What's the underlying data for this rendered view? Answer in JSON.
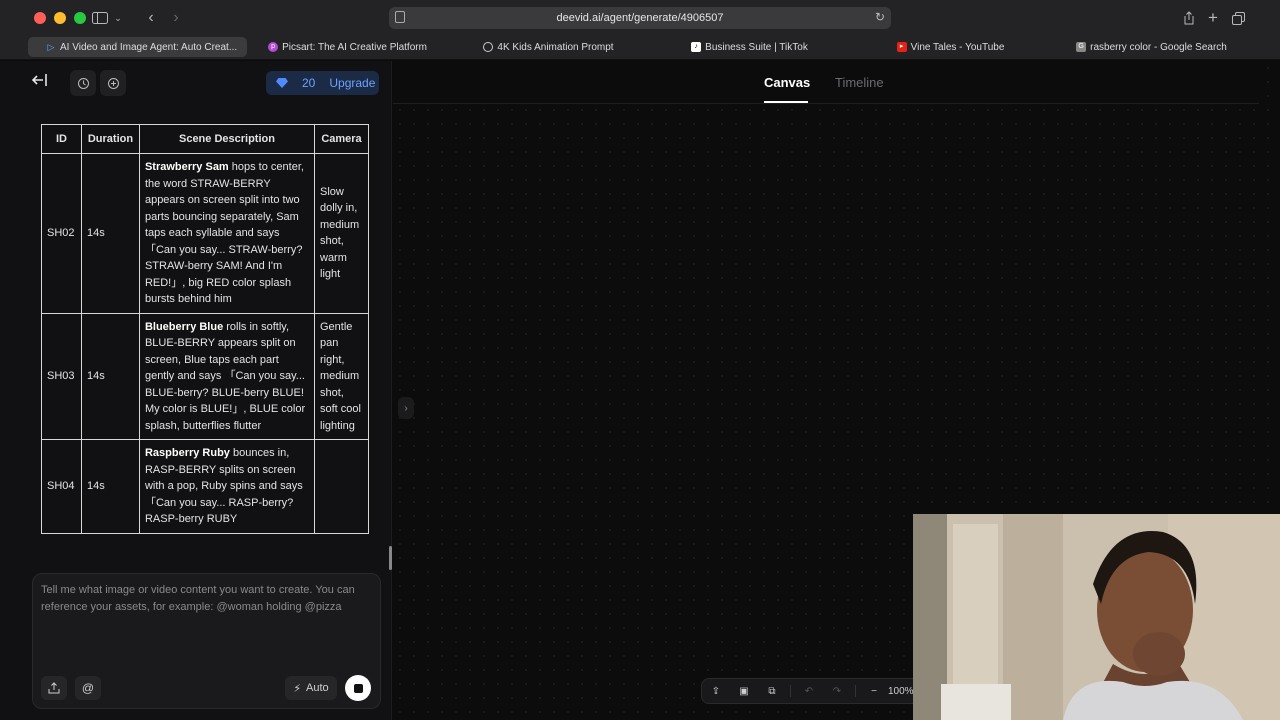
{
  "browser": {
    "url": "deevid.ai/agent/generate/4906507",
    "tabs": [
      {
        "label": "AI Video and Image Agent: Auto Creat...",
        "favicon": "play-icon",
        "active": true
      },
      {
        "label": "Picsart: The AI Creative Platform",
        "favicon": "picsart-icon"
      },
      {
        "label": "4K Kids Animation Prompt",
        "favicon": "openai-icon"
      },
      {
        "label": "Business Suite | TikTok",
        "favicon": "tiktok-icon"
      },
      {
        "label": "Vine Tales - YouTube",
        "favicon": "youtube-icon"
      },
      {
        "label": "rasberry color - Google Search",
        "favicon": "google-icon"
      }
    ]
  },
  "header": {
    "credits": "20",
    "upgrade_label": "Upgrade"
  },
  "table": {
    "headers": [
      "ID",
      "Duration",
      "Scene Description",
      "Camera"
    ],
    "rows": [
      {
        "id": "SH02",
        "duration": "14s",
        "name": "Strawberry Sam",
        "desc": " hops to center, the word STRAW-BERRY appears on screen split into two parts bouncing separately, Sam taps each syllable and says 「Can you say... STRAW-berry? STRAW-berry SAM! And I'm RED!」, big RED color splash bursts behind him",
        "camera": "Slow dolly in, medium shot, warm light"
      },
      {
        "id": "SH03",
        "duration": "14s",
        "name": "Blueberry Blue",
        "desc": " rolls in softly, BLUE-BERRY appears split on screen, Blue taps each part gently and says 「Can you say... BLUE-berry? BLUE-berry BLUE! My color is BLUE!」, BLUE color splash, butterflies flutter",
        "camera": "Gentle pan right, medium shot, soft cool lighting"
      },
      {
        "id": "SH04",
        "duration": "14s",
        "name": "Raspberry Ruby",
        "desc": " bounces in, RASP-BERRY splits on screen with a pop, Ruby spins and says 「Can you say... RASP-berry? RASP-berry RUBY",
        "camera": ""
      }
    ]
  },
  "composer": {
    "placeholder": "Tell me what image or video content you want to create. You can reference your assets, for example: @woman holding @pizza",
    "at_label": "@",
    "auto_label": "Auto"
  },
  "canvas": {
    "tab_canvas": "Canvas",
    "tab_timeline": "Timeline",
    "zoom": "100%"
  }
}
